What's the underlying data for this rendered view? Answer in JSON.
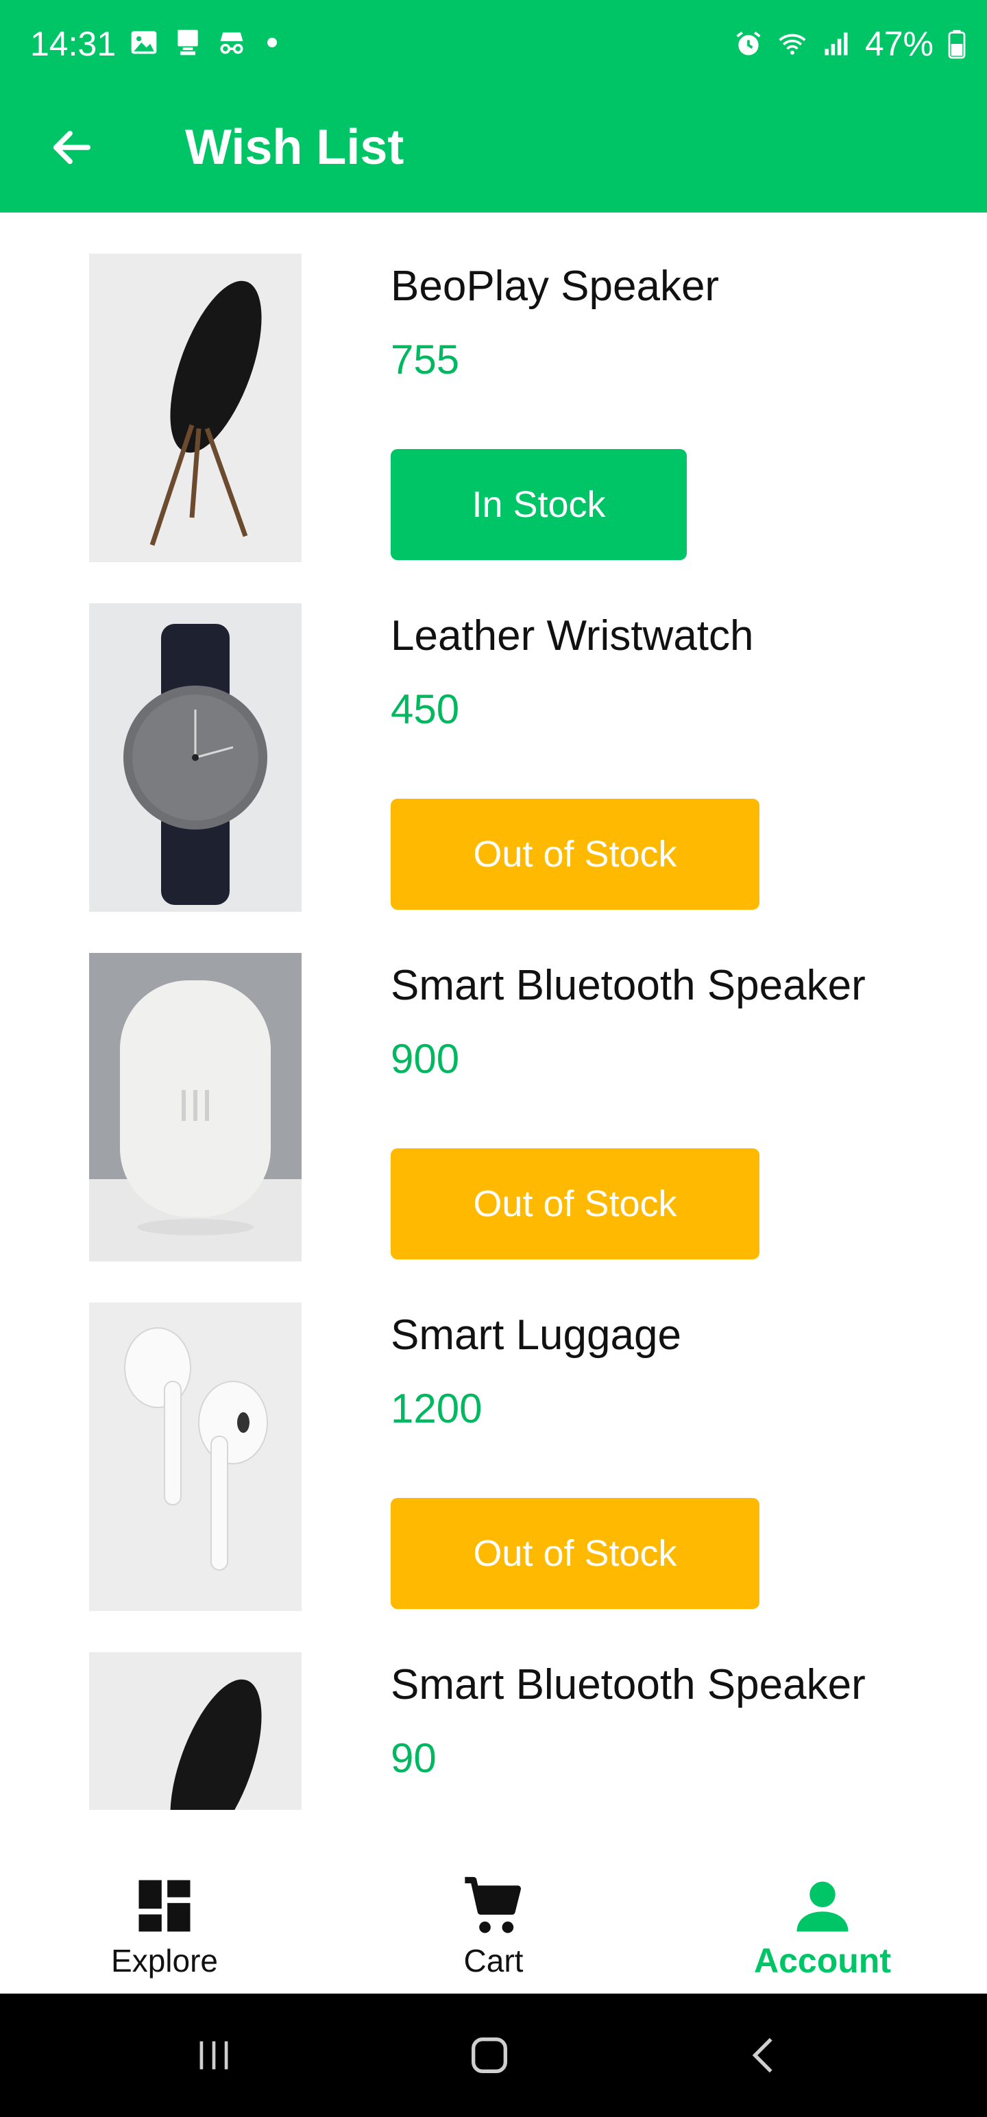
{
  "status_bar": {
    "time": "14:31",
    "battery": "47%"
  },
  "app_bar": {
    "title": "Wish List",
    "back_icon": "arrow-left-icon"
  },
  "colors": {
    "primary": "#00c566",
    "price": "#00b85f",
    "out_of_stock": "#ffb900"
  },
  "wishlist": {
    "items": [
      {
        "name": "BeoPlay Speaker",
        "price": "755",
        "stock_label": "In Stock",
        "in_stock": true,
        "image": "beoplay-speaker"
      },
      {
        "name": "Leather Wristwatch",
        "price": "450",
        "stock_label": "Out of Stock",
        "in_stock": false,
        "image": "wristwatch"
      },
      {
        "name": "Smart Bluetooth Speaker",
        "price": "900",
        "stock_label": "Out of Stock",
        "in_stock": false,
        "image": "white-speaker"
      },
      {
        "name": "Smart Luggage",
        "price": "1200",
        "stock_label": "Out of Stock",
        "in_stock": false,
        "image": "earbuds"
      },
      {
        "name": "Smart Bluetooth Speaker",
        "price": "90",
        "stock_label": "",
        "in_stock": null,
        "image": "beoplay-speaker"
      }
    ]
  },
  "bottom_nav": {
    "items": [
      {
        "label": "Explore",
        "icon": "dashboard-icon",
        "active": false
      },
      {
        "label": "Cart",
        "icon": "cart-icon",
        "active": false
      },
      {
        "label": "Account",
        "icon": "person-icon",
        "active": true
      }
    ]
  },
  "system_nav": {
    "recents_icon": "recents-icon",
    "home_icon": "home-icon",
    "back_icon": "system-back-icon"
  }
}
